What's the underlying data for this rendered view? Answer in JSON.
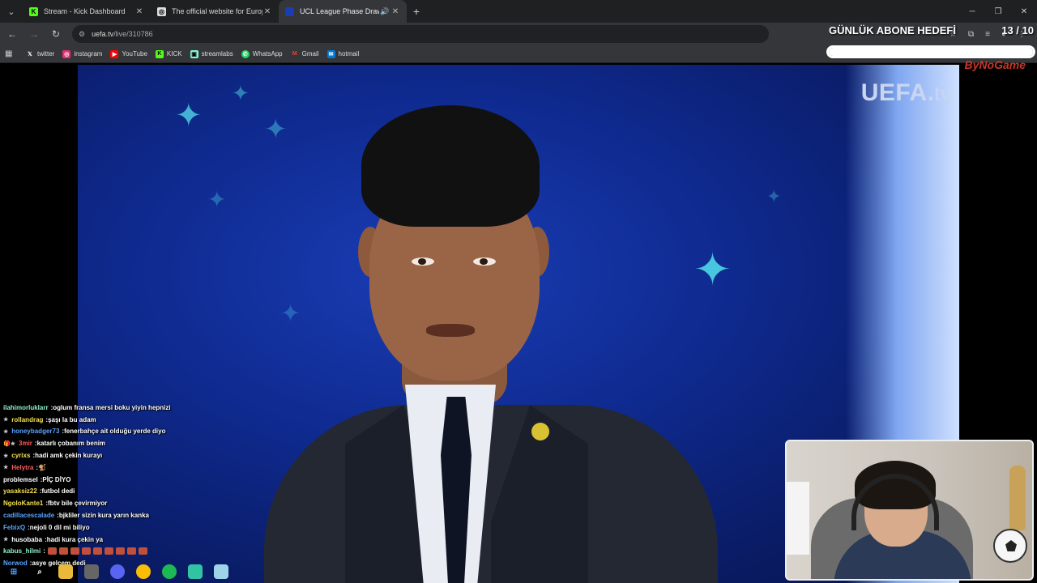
{
  "browser": {
    "tabs": [
      {
        "title": "Stream - Kick Dashboard",
        "favicon_icon": "kick-icon",
        "favicon_color": "#53fc18",
        "active": false
      },
      {
        "title": "The official website for Europea",
        "favicon_icon": "uefa-icon",
        "favicon_color": "#dddddd",
        "active": false
      },
      {
        "title": "UCL League Phase Draw",
        "favicon_icon": "uefa-icon",
        "favicon_color": "#1a3db5",
        "active": true
      }
    ],
    "new_tab_label": "+",
    "address": {
      "host": "uefa.tv",
      "path": "/live/310786"
    },
    "bookmarks": [
      {
        "label": "twitter",
        "icon": "x-icon",
        "color": "#ffffff"
      },
      {
        "label": "instagram",
        "icon": "instagram-icon",
        "color": "#e1306c"
      },
      {
        "label": "YouTube",
        "icon": "youtube-icon",
        "color": "#ff0000"
      },
      {
        "label": "KICK",
        "icon": "kick-icon",
        "color": "#53fc18"
      },
      {
        "label": "streamlabs",
        "icon": "streamlabs-icon",
        "color": "#80f5d2"
      },
      {
        "label": "WhatsApp",
        "icon": "whatsapp-icon",
        "color": "#25d366"
      },
      {
        "label": "Gmail",
        "icon": "gmail-icon",
        "color": "#ea4335"
      },
      {
        "label": "hotmail",
        "icon": "hotmail-icon",
        "color": "#0078d4"
      }
    ]
  },
  "video": {
    "logo_main": "UEFA.",
    "logo_suffix": "tv"
  },
  "goal": {
    "title": "GÜNLÜK ABONE HEDEFİ",
    "count": "13 / 10",
    "progress_fraction": 1.0,
    "brand": "ByNoGame"
  },
  "chat": [
    {
      "user": "ilahimorluklarr",
      "user_color": "#8ef0c8",
      "message": "oglum fransa mersi boku yiyin hepnizi",
      "badge": ""
    },
    {
      "user": "rollandrag",
      "user_color": "#f5e04b",
      "message": "şaşı la bu adam",
      "badge": "★"
    },
    {
      "user": "honeybadger73",
      "user_color": "#5aa3ff",
      "message": "fenerbahçe ait olduğu yerde diyo",
      "badge": "★"
    },
    {
      "user": "3mir",
      "user_color": "#ff5a5a",
      "message": "katarlı çobanım benim",
      "badge": "🎁★"
    },
    {
      "user": "cyrixs",
      "user_color": "#f5e04b",
      "message": "hadi amk çekin kurayı",
      "badge": "★"
    },
    {
      "user": "Helytra",
      "user_color": "#ff6060",
      "message": "🐒",
      "badge": "★"
    },
    {
      "user": "problemsel",
      "user_color": "#ffffff",
      "message": "PİÇ DİYO",
      "badge": ""
    },
    {
      "user": "yasaksiz22",
      "user_color": "#f5e04b",
      "message": "futbol dedi",
      "badge": ""
    },
    {
      "user": "NgoloKante1",
      "user_color": "#f5e04b",
      "message": "fbtv bile çevirmiyor",
      "badge": ""
    },
    {
      "user": "cadillacescalade",
      "user_color": "#5aa3ff",
      "message": "bjkliler sizin kura yarın kanka",
      "badge": ""
    },
    {
      "user": "FebixQ",
      "user_color": "#5aa3ff",
      "message": "nejoli 0 dil mi biliyo",
      "badge": ""
    },
    {
      "user": "husobaba",
      "user_color": "#ffffff",
      "message": "hadi kura çekin ya",
      "badge": "★"
    },
    {
      "user": "kabus_hilmi",
      "user_color": "#8ef0c8",
      "message": "",
      "badge": "",
      "emote_count": 9
    },
    {
      "user": "Norwod",
      "user_color": "#5aa3ff",
      "message": "asye gelcem dedi",
      "badge": ""
    }
  ]
}
